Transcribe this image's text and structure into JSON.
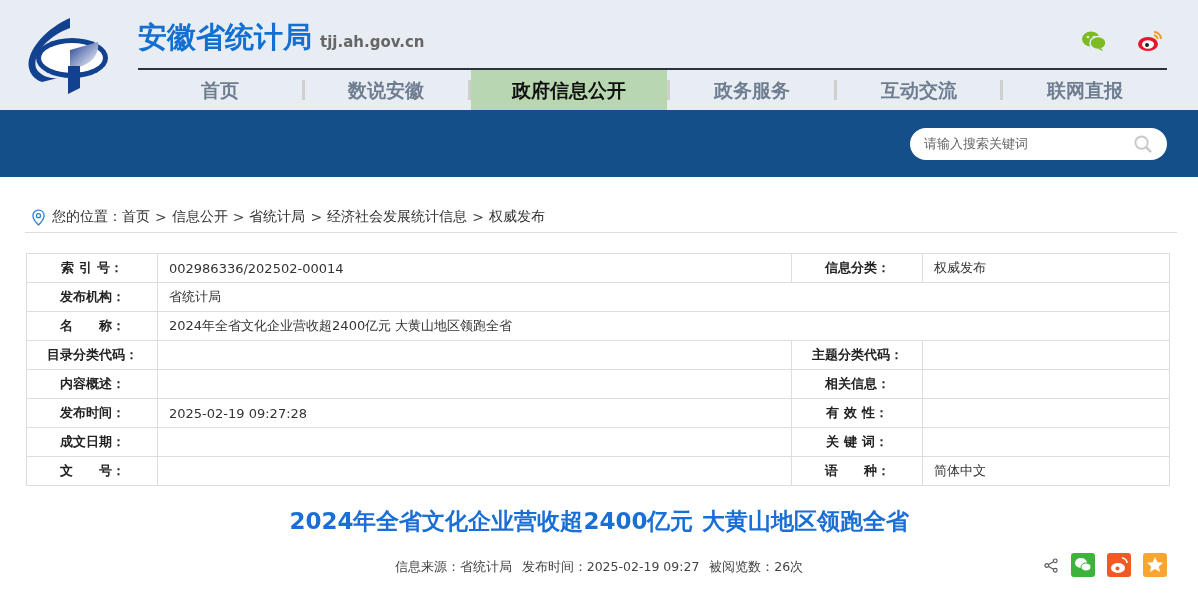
{
  "site": {
    "title": "安徽省统计局",
    "domain": "tjj.ah.gov.cn"
  },
  "nav": [
    {
      "label": "首页",
      "selected": false
    },
    {
      "label": "数说安徽",
      "selected": false
    },
    {
      "label": "政府信息公开",
      "selected": true
    },
    {
      "label": "政务服务",
      "selected": false
    },
    {
      "label": "互动交流",
      "selected": false
    },
    {
      "label": "联网直报",
      "selected": false
    }
  ],
  "search": {
    "placeholder": "请输入搜索关键词"
  },
  "breadcrumb": {
    "prefix": "您的位置：",
    "items": [
      "首页",
      "信息公开",
      "省统计局",
      "经济社会发展统计信息",
      "权威发布"
    ],
    "separator": ">"
  },
  "info_table": [
    [
      {
        "label": "索 引 号：",
        "value": "002986336/202502-00014"
      },
      {
        "label": "信息分类：",
        "value": "权威发布"
      }
    ],
    [
      {
        "label": "发布机构：",
        "value": "省统计局"
      }
    ],
    [
      {
        "label": "名　　称：",
        "value": "2024年全省文化企业营收超2400亿元 大黄山地区领跑全省"
      }
    ],
    [
      {
        "label": "目录分类代码："
      },
      {
        "label": "主题分类代码："
      }
    ],
    [
      {
        "label": "内容概述："
      },
      {
        "label": "相关信息："
      }
    ],
    [
      {
        "label": "发布时间：",
        "value": "2025-02-19 09:27:28"
      },
      {
        "label": "有 效 性："
      }
    ],
    [
      {
        "label": "成文日期："
      },
      {
        "label": "关 键 词："
      }
    ],
    [
      {
        "label": "文　　号："
      },
      {
        "label": "语　　种：",
        "value": "简体中文"
      }
    ]
  ],
  "article": {
    "title": "2024年全省文化企业营收超2400亿元 大黄山地区领跑全省",
    "meta": [
      "信息来源：省统计局",
      "发布时间：2025-02-19 09:27",
      "被阅览数：26次"
    ]
  }
}
